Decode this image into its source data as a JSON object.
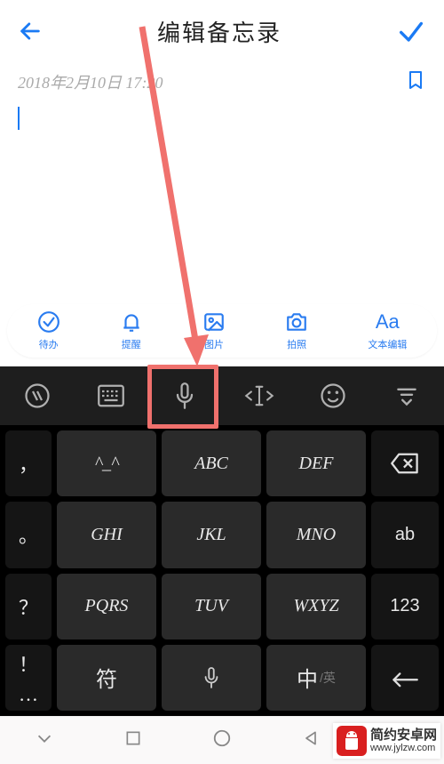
{
  "header": {
    "title": "编辑备忘录"
  },
  "note": {
    "timestamp": "2018年2月10日  17:20"
  },
  "toolbar": {
    "todo": "待办",
    "remind": "提醒",
    "image": "图片",
    "camera": "拍照",
    "textedit": "文本编辑",
    "textedit_glyph": "Aa"
  },
  "keys": {
    "comma": "，",
    "face": "^_^",
    "abc": "ABC",
    "def": "DEF",
    "period": "。",
    "ghi": "GHI",
    "jkl": "JKL",
    "mno": "MNO",
    "ab": "ab",
    "qmark": "？",
    "pqrs": "PQRS",
    "tuv": "TUV",
    "wxyz": "WXYZ",
    "num": "123",
    "excl": "！",
    "more": "…",
    "symbol": "符",
    "lang_main": "中",
    "lang_sub": "/英"
  },
  "watermark": {
    "name": "简约安卓网",
    "url": "www.jylzw.com"
  }
}
